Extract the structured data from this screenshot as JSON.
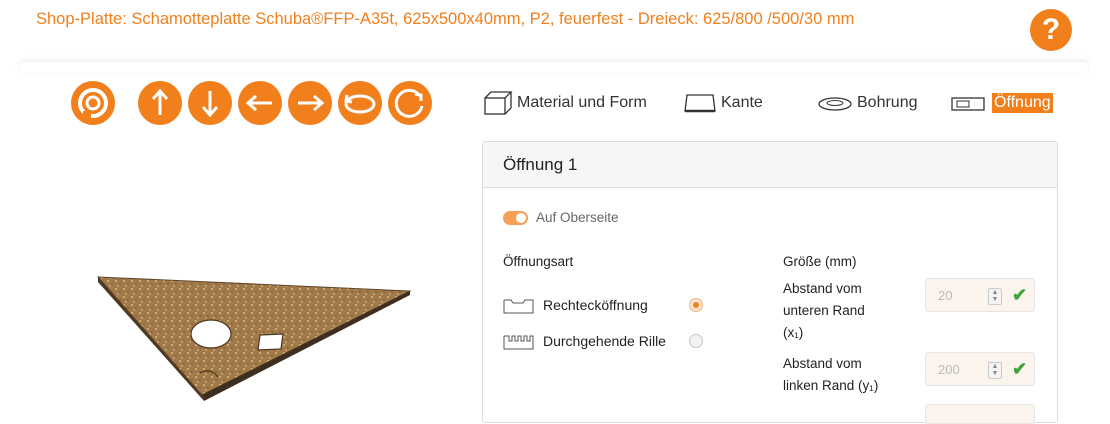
{
  "page": {
    "title": "Shop-Platte: Schamotteplatte Schuba®FFP-A35t, 625x500x40mm, P2, feuerfest - Dreieck: 625/800 /500/30 mm",
    "help_symbol": "?"
  },
  "controls": [
    {
      "icon": "rotate-reset-icon"
    },
    {
      "icon": "arrow-up-icon"
    },
    {
      "icon": "arrow-down-icon"
    },
    {
      "icon": "arrow-left-icon"
    },
    {
      "icon": "arrow-right-icon"
    },
    {
      "icon": "rotate-left-icon"
    },
    {
      "icon": "rotate-right-icon"
    }
  ],
  "tabs": [
    {
      "label": "Material und Form",
      "icon": "cube-icon",
      "active": false
    },
    {
      "label": "Kante",
      "icon": "edge-icon",
      "active": false
    },
    {
      "label": "Bohrung",
      "icon": "hole-icon",
      "active": false
    },
    {
      "label": "Öffnung",
      "icon": "opening-icon",
      "active": true
    }
  ],
  "panel": {
    "heading": "Öffnung 1",
    "toggle_label": "Auf Oberseite",
    "toggle_on": true,
    "type_heading": "Öffnungsart",
    "options": [
      {
        "label": "Rechtecköffnung",
        "icon": "rectangle-opening-icon",
        "selected": true
      },
      {
        "label": "Durchgehende Rille",
        "icon": "groove-icon",
        "selected": false
      }
    ],
    "size_heading": "Größe (mm)",
    "fields": [
      {
        "label_line1": "Abstand vom",
        "label_line2": "unteren Rand",
        "label_line3": "(x₁)",
        "value": "20"
      },
      {
        "label_line1": "Abstand vom",
        "label_line2": "linken Rand (y₁)",
        "value": "200"
      }
    ]
  },
  "colors": {
    "accent": "#f07f1c",
    "check": "#3fa63f"
  }
}
